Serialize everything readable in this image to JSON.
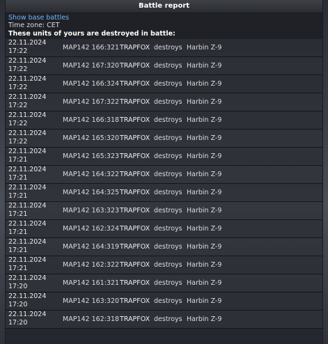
{
  "window": {
    "title": "Battle report"
  },
  "header": {
    "show_base_link": "Show base battles",
    "timezone": "Time zone: CET",
    "destroyed_title": "These units of yours are destroyed in battle:"
  },
  "rows": [
    {
      "date": "22.11.2024",
      "time": "17:22",
      "coords": "MAP142 166:321",
      "unit": "TRAPFOX",
      "verb": "destroys",
      "target": "Harbin Z-9"
    },
    {
      "date": "22.11.2024",
      "time": "17:22",
      "coords": "MAP142 167:320",
      "unit": "TRAPFOX",
      "verb": "destroys",
      "target": "Harbin Z-9"
    },
    {
      "date": "22.11.2024",
      "time": "17:22",
      "coords": "MAP142 166:324",
      "unit": "TRAPFOX",
      "verb": "destroys",
      "target": "Harbin Z-9"
    },
    {
      "date": "22.11.2024",
      "time": "17:22",
      "coords": "MAP142 167:322",
      "unit": "TRAPFOX",
      "verb": "destroys",
      "target": "Harbin Z-9"
    },
    {
      "date": "22.11.2024",
      "time": "17:22",
      "coords": "MAP142 166:318",
      "unit": "TRAPFOX",
      "verb": "destroys",
      "target": "Harbin Z-9"
    },
    {
      "date": "22.11.2024",
      "time": "17:22",
      "coords": "MAP142 165:320",
      "unit": "TRAPFOX",
      "verb": "destroys",
      "target": "Harbin Z-9"
    },
    {
      "date": "22.11.2024",
      "time": "17:21",
      "coords": "MAP142 165:323",
      "unit": "TRAPFOX",
      "verb": "destroys",
      "target": "Harbin Z-9"
    },
    {
      "date": "22.11.2024",
      "time": "17:21",
      "coords": "MAP142 164:322",
      "unit": "TRAPFOX",
      "verb": "destroys",
      "target": "Harbin Z-9"
    },
    {
      "date": "22.11.2024",
      "time": "17:21",
      "coords": "MAP142 164:325",
      "unit": "TRAPFOX",
      "verb": "destroys",
      "target": "Harbin Z-9"
    },
    {
      "date": "22.11.2024",
      "time": "17:21",
      "coords": "MAP142 163:323",
      "unit": "TRAPFOX",
      "verb": "destroys",
      "target": "Harbin Z-9"
    },
    {
      "date": "22.11.2024",
      "time": "17:21",
      "coords": "MAP142 162:324",
      "unit": "TRAPFOX",
      "verb": "destroys",
      "target": "Harbin Z-9"
    },
    {
      "date": "22.11.2024",
      "time": "17:21",
      "coords": "MAP142 164:319",
      "unit": "TRAPFOX",
      "verb": "destroys",
      "target": "Harbin Z-9"
    },
    {
      "date": "22.11.2024",
      "time": "17:21",
      "coords": "MAP142 162:322",
      "unit": "TRAPFOX",
      "verb": "destroys",
      "target": "Harbin Z-9"
    },
    {
      "date": "22.11.2024",
      "time": "17:20",
      "coords": "MAP142 161:321",
      "unit": "TRAPFOX",
      "verb": "destroys",
      "target": "Harbin Z-9"
    },
    {
      "date": "22.11.2024",
      "time": "17:20",
      "coords": "MAP142 163:320",
      "unit": "TRAPFOX",
      "verb": "destroys",
      "target": "Harbin Z-9"
    },
    {
      "date": "22.11.2024",
      "time": "17:20",
      "coords": "MAP142 162:318",
      "unit": "TRAPFOX",
      "verb": "destroys",
      "target": "Harbin Z-9"
    }
  ]
}
